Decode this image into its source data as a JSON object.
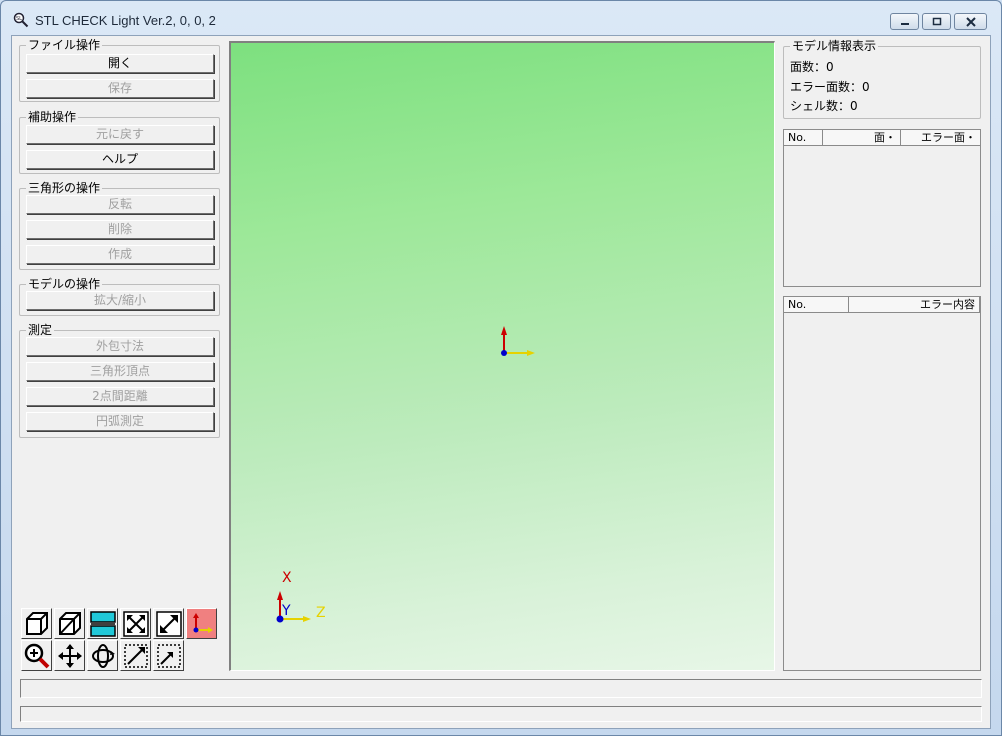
{
  "window": {
    "title": "STL CHECK Light Ver.2, 0, 0, 2",
    "minimize_icon": "minimize-icon",
    "maximize_icon": "maximize-icon",
    "close_icon": "close-icon"
  },
  "left_panel": {
    "file_group": {
      "label": "ファイル操作",
      "open": "開く",
      "save": "保存"
    },
    "assist_group": {
      "label": "補助操作",
      "undo": "元に戻す",
      "help": "ヘルプ"
    },
    "triangle_group": {
      "label": "三角形の操作",
      "flip": "反転",
      "delete": "削除",
      "create": "作成"
    },
    "model_group": {
      "label": "モデルの操作",
      "zoom": "拡大/縮小"
    },
    "measure_group": {
      "label": "測定",
      "bbox": "外包寸法",
      "vertex": "三角形頂点",
      "distance": "2点間距離",
      "arc": "円弧測定"
    }
  },
  "toolbar": {
    "icons": [
      "cube-solid-icon",
      "cube-shaded-icon",
      "cross-section-icon",
      "fit-expand-icon",
      "diagonal-expand-icon",
      "axis-toggle-icon",
      "zoom-icon",
      "pan-icon",
      "rotate-icon",
      "zoom-window-icon",
      "zoom-window-small-icon"
    ]
  },
  "viewport": {
    "axis_x_label": "X",
    "axis_y_label": "Y",
    "axis_z_label": "Z"
  },
  "model_info": {
    "label": "モデル情報表示",
    "faces": "面数：0",
    "error_faces": "エラー面数：0",
    "shells": "シェル数：0"
  },
  "shell_list": {
    "col_no": "No.",
    "col_faces": "面・",
    "col_error_faces": "エラー面・"
  },
  "error_list": {
    "col_no": "No.",
    "col_error": "エラー内容"
  },
  "colors": {
    "viewport_top": "#7de07f",
    "viewport_bottom": "#e7f6e7",
    "axis_red": "#cc0000",
    "axis_yellow": "#e6d200",
    "axis_blue": "#0000cc"
  }
}
